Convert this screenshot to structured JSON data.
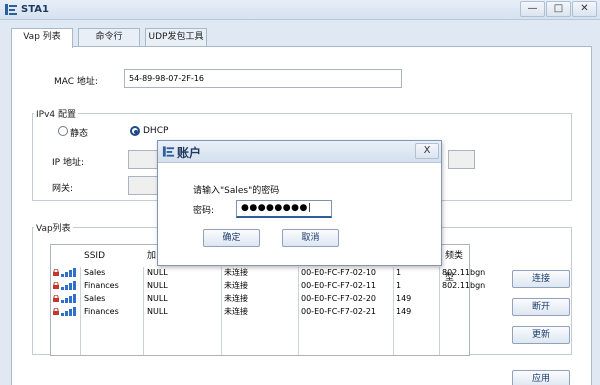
{
  "window": {
    "title": "STA1",
    "minimize_glyph": "—",
    "maximize_glyph": "□",
    "close_glyph": "✕"
  },
  "tabs": [
    {
      "label": "Vap 列表",
      "active": true
    },
    {
      "label": "命令行",
      "active": false
    },
    {
      "label": "UDP发包工具",
      "active": false
    }
  ],
  "mac": {
    "label": "MAC 地址:",
    "value": "54-89-98-07-2F-16"
  },
  "ipv4": {
    "group_title": "IPv4 配置",
    "static_label": "静态",
    "dhcp_label": "DHCP",
    "selected": "DHCP",
    "ip_label": "IP 地址:",
    "gateway_label": "网关:"
  },
  "vap": {
    "group_title": "Vap列表",
    "columns": [
      "SSID",
      "加",
      "",
      "",
      "频类型"
    ],
    "rows": [
      {
        "ssid": "Sales",
        "auth": "NULL",
        "status": "未连接",
        "bssid": "00-E0-FC-F7-02-10",
        "channel": "1",
        "band": "802.11bgn"
      },
      {
        "ssid": "Finances",
        "auth": "NULL",
        "status": "未连接",
        "bssid": "00-E0-FC-F7-02-11",
        "channel": "1",
        "band": "802.11bgn"
      },
      {
        "ssid": "Sales",
        "auth": "NULL",
        "status": "未连接",
        "bssid": "00-E0-FC-F7-02-20",
        "channel": "149",
        "band": ""
      },
      {
        "ssid": "Finances",
        "auth": "NULL",
        "status": "未连接",
        "bssid": "00-E0-FC-F7-02-21",
        "channel": "149",
        "band": ""
      }
    ],
    "buttons": {
      "connect": "连接",
      "disconnect": "断开",
      "refresh": "更新"
    }
  },
  "apply_label": "应用",
  "dialog": {
    "title": "账户",
    "close_glyph": "X",
    "prompt": "请输入\"Sales\"的密码",
    "password_label": "密码:",
    "password_value": "●●●●●●●●|",
    "ok_label": "确定",
    "cancel_label": "取消"
  },
  "colors": {
    "accent": "#1d4a8a",
    "lock": "#c0392b",
    "signal": "#2f6fce"
  }
}
